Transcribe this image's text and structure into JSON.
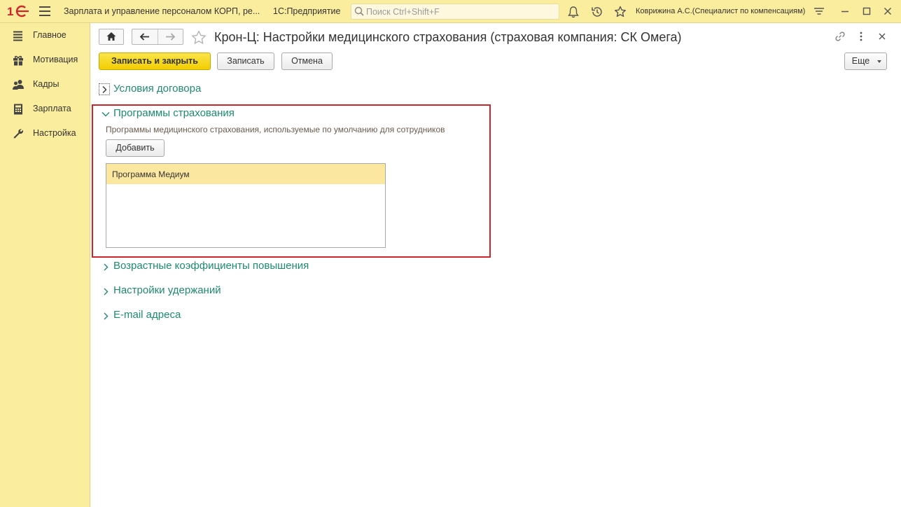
{
  "app": {
    "title": "Зарплата и управление персоналом КОРП, ре...",
    "platform": "1С:Предприятие",
    "search_placeholder": "Поиск Ctrl+Shift+F",
    "user": "Коврижина А.С.(Специалист по компенсациям)"
  },
  "sidebar": {
    "items": [
      {
        "label": "Главное",
        "icon": "menu-lines-icon"
      },
      {
        "label": "Мотивация",
        "icon": "gift-icon"
      },
      {
        "label": "Кадры",
        "icon": "people-icon"
      },
      {
        "label": "Зарплата",
        "icon": "calculator-icon"
      },
      {
        "label": "Настройка",
        "icon": "wrench-icon"
      }
    ]
  },
  "form": {
    "title": "Крон-Ц: Настройки медицинского страхования (страховая компания: СК Омега)",
    "buttons": {
      "save_close": "Записать и закрыть",
      "save": "Записать",
      "cancel": "Отмена",
      "more": "Еще"
    },
    "groups": {
      "contract": "Условия договора",
      "programs": "Программы страхования",
      "age_coefficients": "Возрастные коэффициенты повышения",
      "deductions": "Настройки удержаний",
      "email": "E-mail адреса"
    },
    "programs": {
      "description": "Программы медицинского страхования, используемые по умолчанию для сотрудников",
      "add_button": "Добавить",
      "items": [
        "Программа Медиум"
      ]
    }
  },
  "colors": {
    "accent": "#fbed9e",
    "group_label": "#1d8b6e",
    "selected_row": "#fce7a0",
    "highlight_border": "#d0242b",
    "primary_button": "#f5d500"
  }
}
